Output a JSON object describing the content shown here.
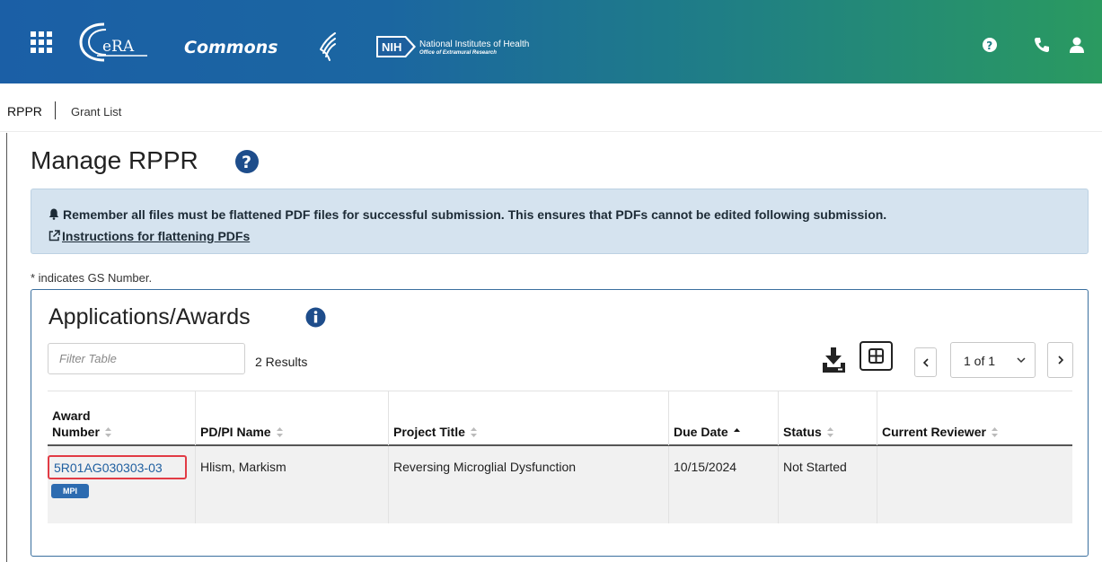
{
  "header": {
    "logo_text": "eRA",
    "product": "Commons",
    "nih_badge": "NIH",
    "nih_name": "National Institutes of Health",
    "nih_office": "Office of Extramural Research",
    "icons": [
      "grid-menu-icon",
      "help-icon",
      "phone-icon",
      "user-icon"
    ]
  },
  "breadcrumb": {
    "root": "RPPR",
    "current": "Grant List"
  },
  "page": {
    "title": "Manage RPPR"
  },
  "alert": {
    "message": "Remember all files must be flattened PDF files for successful submission. This ensures that PDFs cannot be edited following submission.",
    "link": "Instructions for flattening PDFs",
    "background": "#d5e3ef"
  },
  "note": "* indicates GS Number.",
  "panel": {
    "title": "Applications/Awards",
    "filter_placeholder": "Filter Table",
    "results": "2 Results",
    "pagination": "1 of 1"
  },
  "table": {
    "columns": [
      {
        "label_line1": "Award",
        "label_line2": "Number"
      },
      {
        "label": "PD/PI Name"
      },
      {
        "label": "Project Title"
      },
      {
        "label": "Due Date"
      },
      {
        "label": "Status"
      },
      {
        "label": "Current Reviewer"
      }
    ],
    "rows": [
      {
        "award_number": "5R01AG030303-03",
        "badge": "MPI",
        "pi_name": "Hlism, Markism",
        "project_title": "Reversing Microglial Dysfunction",
        "due_date": "10/15/2024",
        "status": "Not Started",
        "current_reviewer": ""
      }
    ]
  },
  "colors": {
    "accent_link": "#1f5fa0",
    "highlight_border": "#e23b45",
    "badge": "#2c6bb0"
  }
}
